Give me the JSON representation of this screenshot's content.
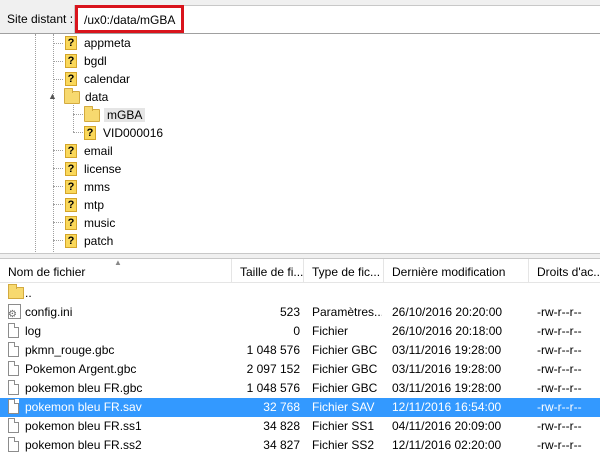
{
  "remote": {
    "label": "Site distant :",
    "path": "/ux0:/data/mGBA"
  },
  "tree": {
    "items": [
      {
        "label": "appmeta",
        "icon": "question-icon"
      },
      {
        "label": "bgdl",
        "icon": "question-icon"
      },
      {
        "label": "calendar",
        "icon": "question-icon"
      },
      {
        "label": "data",
        "icon": "folder-icon",
        "expanded": true
      },
      {
        "label": "mGBA",
        "icon": "folder-icon",
        "selected": true
      },
      {
        "label": "VID000016",
        "icon": "question-icon"
      },
      {
        "label": "email",
        "icon": "question-icon"
      },
      {
        "label": "license",
        "icon": "question-icon"
      },
      {
        "label": "mms",
        "icon": "question-icon"
      },
      {
        "label": "mtp",
        "icon": "question-icon"
      },
      {
        "label": "music",
        "icon": "question-icon"
      },
      {
        "label": "patch",
        "icon": "question-icon"
      }
    ]
  },
  "list": {
    "columns": {
      "name": "Nom de fichier",
      "size": "Taille de fi...",
      "type": "Type de fic...",
      "modified": "Dernière modification",
      "perms": "Droits d'ac..."
    },
    "rows": [
      {
        "name": "..",
        "size": "",
        "type": "",
        "modified": "",
        "perms": "",
        "icon": "folder-up-icon"
      },
      {
        "name": "config.ini",
        "size": "523",
        "type": "Paramètres...",
        "modified": "26/10/2016 20:20:00",
        "perms": "-rw-r--r--",
        "icon": "config-file-icon"
      },
      {
        "name": "log",
        "size": "0",
        "type": "Fichier",
        "modified": "26/10/2016 20:18:00",
        "perms": "-rw-r--r--",
        "icon": "file-icon"
      },
      {
        "name": "pkmn_rouge.gbc",
        "size": "1 048 576",
        "type": "Fichier GBC",
        "modified": "03/11/2016 19:28:00",
        "perms": "-rw-r--r--",
        "icon": "file-icon"
      },
      {
        "name": "Pokemon Argent.gbc",
        "size": "2 097 152",
        "type": "Fichier GBC",
        "modified": "03/11/2016 19:28:00",
        "perms": "-rw-r--r--",
        "icon": "file-icon"
      },
      {
        "name": "pokemon bleu FR.gbc",
        "size": "1 048 576",
        "type": "Fichier GBC",
        "modified": "03/11/2016 19:28:00",
        "perms": "-rw-r--r--",
        "icon": "file-icon"
      },
      {
        "name": "pokemon bleu FR.sav",
        "size": "32 768",
        "type": "Fichier SAV",
        "modified": "12/11/2016 16:54:00",
        "perms": "-rw-r--r--",
        "icon": "file-icon",
        "selected": true
      },
      {
        "name": "pokemon bleu FR.ss1",
        "size": "34 828",
        "type": "Fichier SS1",
        "modified": "04/11/2016 20:09:00",
        "perms": "-rw-r--r--",
        "icon": "file-icon"
      },
      {
        "name": "pokemon bleu FR.ss2",
        "size": "34 827",
        "type": "Fichier SS2",
        "modified": "12/11/2016 02:20:00",
        "perms": "-rw-r--r--",
        "icon": "file-icon"
      }
    ]
  },
  "colors": {
    "highlight": "#d9141c",
    "selection": "#3399ff"
  }
}
